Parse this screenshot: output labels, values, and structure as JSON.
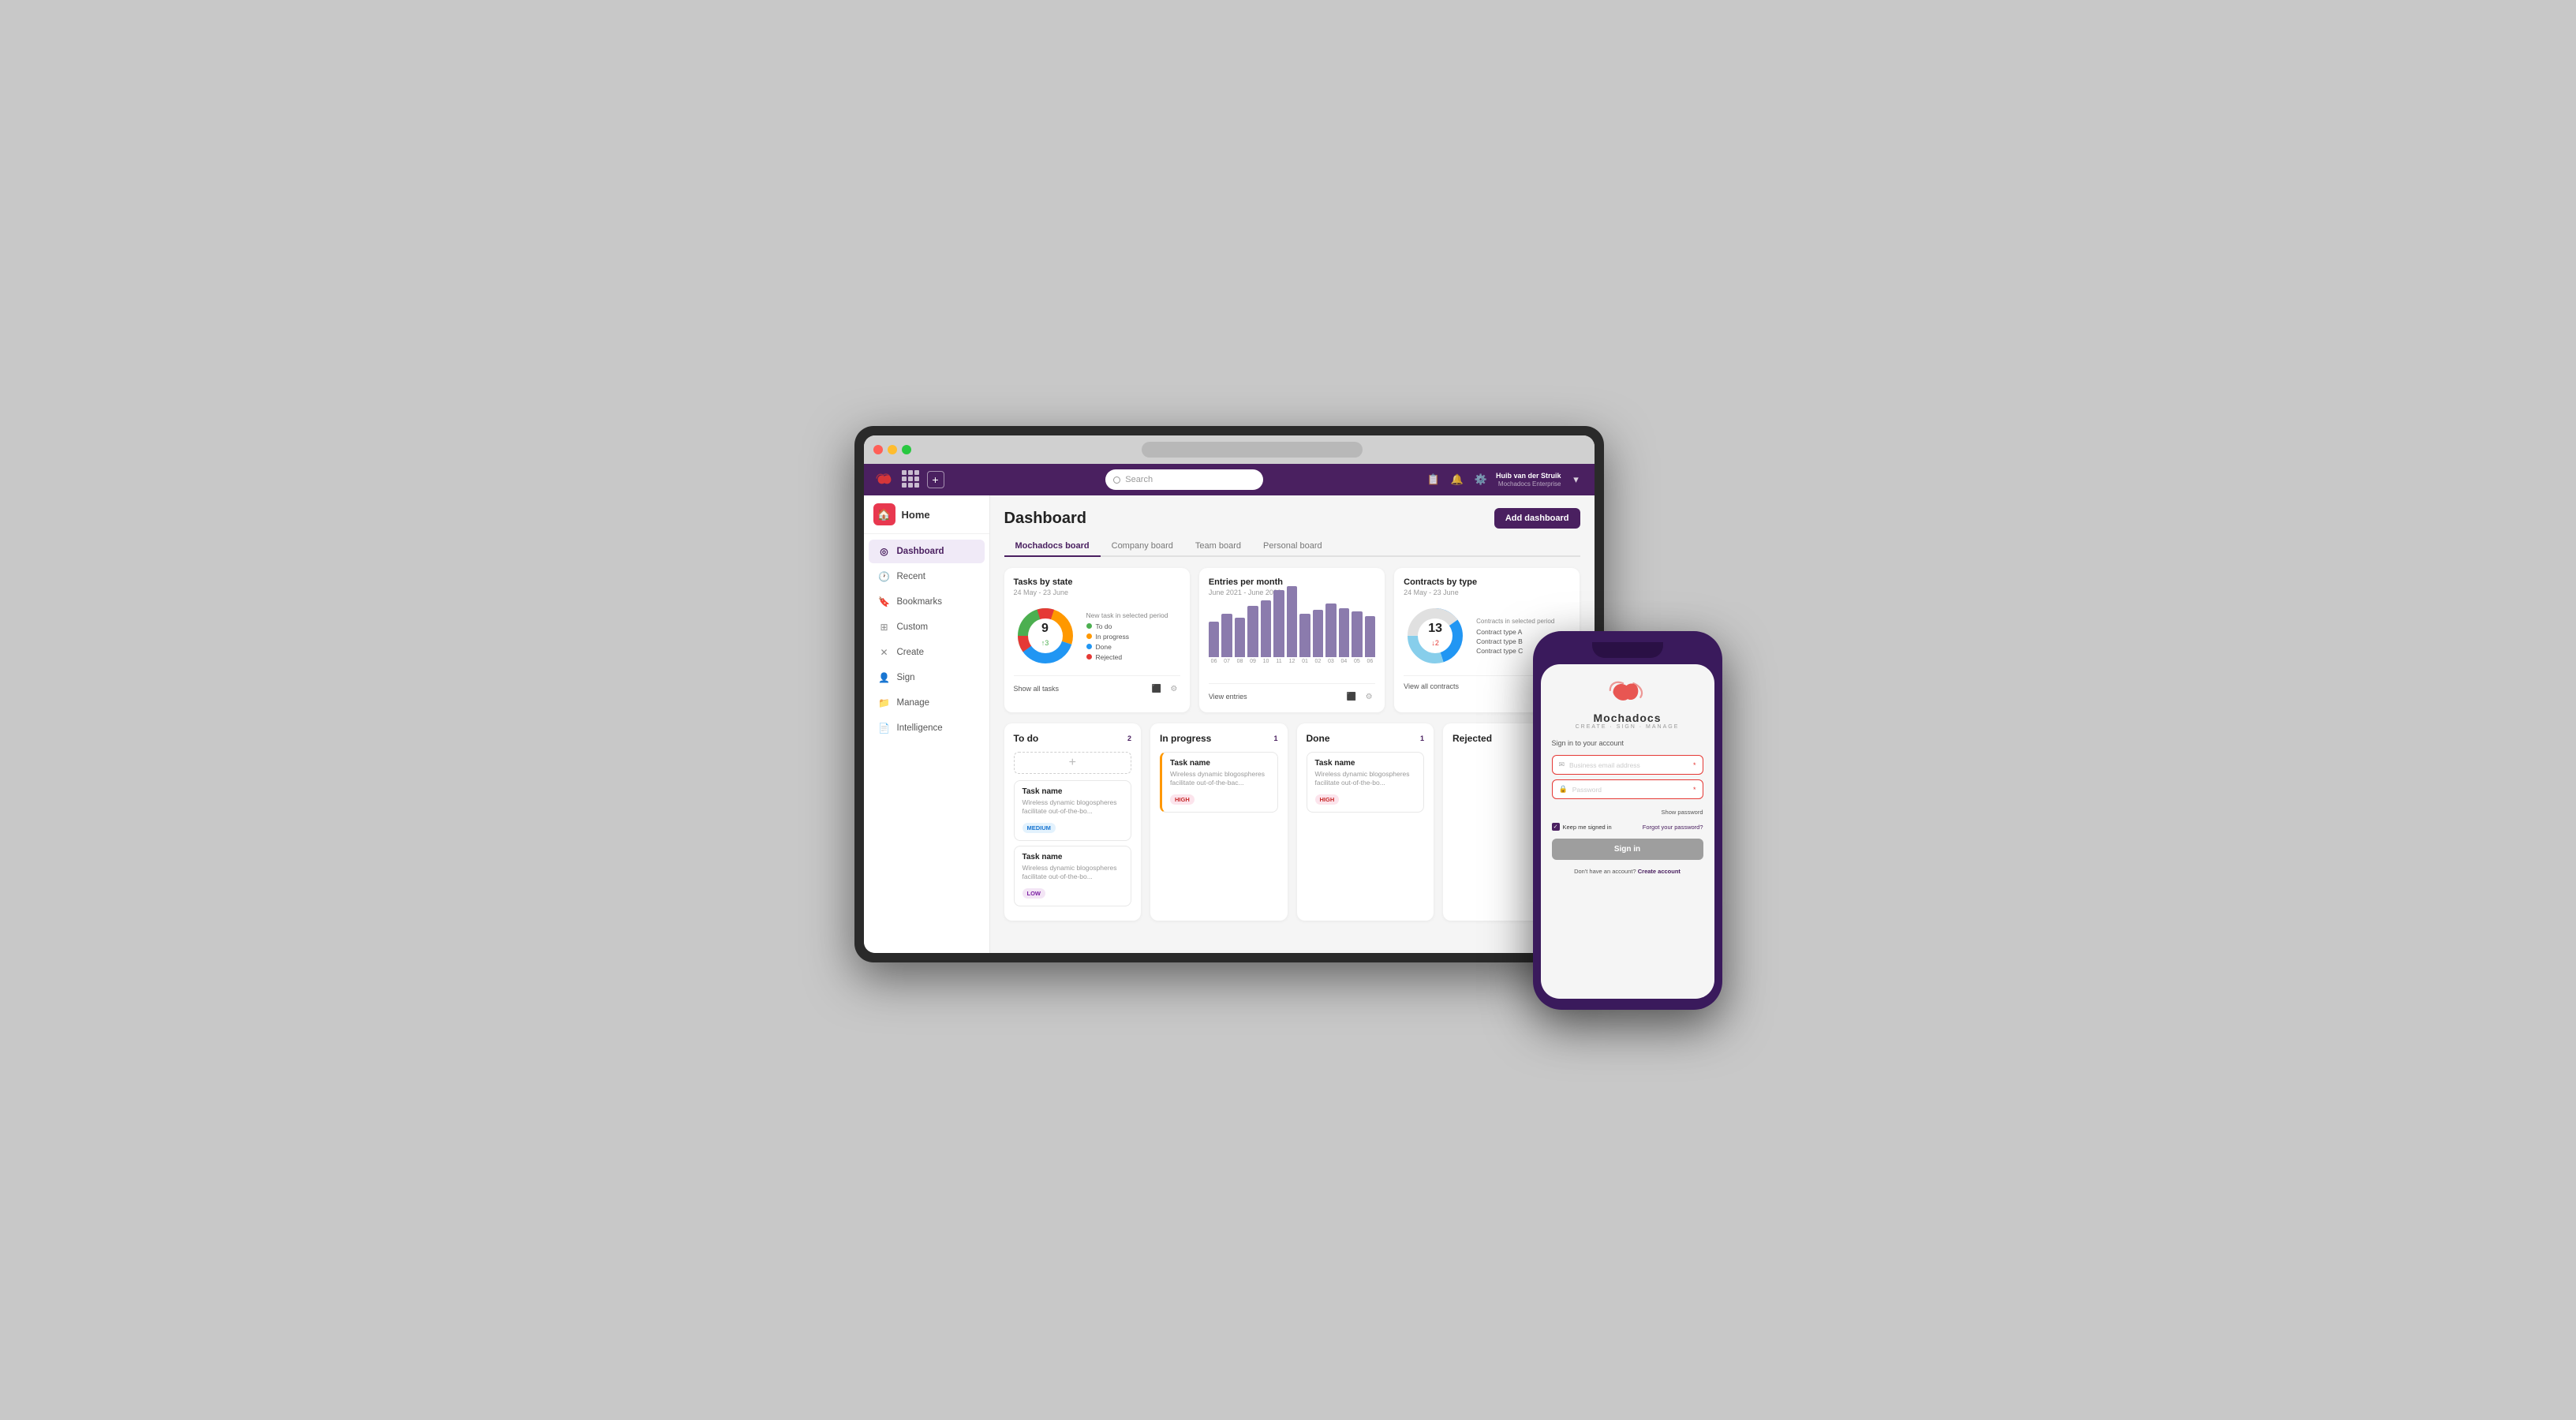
{
  "browser": {
    "traffic_lights": [
      "red",
      "yellow",
      "green"
    ]
  },
  "topnav": {
    "search_placeholder": "Search",
    "user_name": "Huib van der Struik",
    "user_company": "Mochadocs Enterprise"
  },
  "sidebar": {
    "home_label": "Home",
    "items": [
      {
        "id": "dashboard",
        "label": "Dashboard",
        "active": true
      },
      {
        "id": "recent",
        "label": "Recent",
        "active": false
      },
      {
        "id": "bookmarks",
        "label": "Bookmarks",
        "active": false
      },
      {
        "id": "custom",
        "label": "Custom",
        "active": false
      },
      {
        "id": "create",
        "label": "Create",
        "active": false
      },
      {
        "id": "sign",
        "label": "Sign",
        "active": false
      },
      {
        "id": "manage",
        "label": "Manage",
        "active": false
      },
      {
        "id": "intelligence",
        "label": "Intelligence",
        "active": false
      }
    ]
  },
  "page": {
    "title": "Dashboard",
    "add_dashboard_btn": "Add dashboard"
  },
  "tabs": [
    {
      "id": "mochadocs",
      "label": "Mochadocs board",
      "active": true
    },
    {
      "id": "company",
      "label": "Company board",
      "active": false
    },
    {
      "id": "team",
      "label": "Team board",
      "active": false
    },
    {
      "id": "personal",
      "label": "Personal board",
      "active": false
    }
  ],
  "chart_tasks": {
    "title": "Tasks by state",
    "subtitle": "24 May - 23 June",
    "new_task_label": "New task in selected period",
    "count": "9",
    "change": "↑3",
    "legend": [
      {
        "label": "To do",
        "color": "#4caf50"
      },
      {
        "label": "In progress",
        "color": "#ff9800"
      },
      {
        "label": "Done",
        "color": "#2196f3"
      },
      {
        "label": "Rejected",
        "color": "#e53935"
      }
    ],
    "footer_link": "Show all tasks",
    "donut_segments": [
      {
        "color": "#4caf50",
        "value": 30
      },
      {
        "color": "#ff9800",
        "value": 25
      },
      {
        "color": "#2196f3",
        "value": 35
      },
      {
        "color": "#e53935",
        "value": 10
      }
    ]
  },
  "chart_entries": {
    "title": "Entries per month",
    "subtitle": "June 2021 - June 2022",
    "footer_link": "View entries",
    "bars": [
      {
        "label": "06",
        "height": 45
      },
      {
        "label": "07",
        "height": 55
      },
      {
        "label": "08",
        "height": 50
      },
      {
        "label": "09",
        "height": 65
      },
      {
        "label": "10",
        "height": 72
      },
      {
        "label": "11",
        "height": 85
      },
      {
        "label": "12",
        "height": 90
      },
      {
        "label": "01",
        "height": 55
      },
      {
        "label": "02",
        "height": 60
      },
      {
        "label": "03",
        "height": 68
      },
      {
        "label": "04",
        "height": 62
      },
      {
        "label": "05",
        "height": 58
      },
      {
        "label": "06",
        "height": 52
      }
    ]
  },
  "chart_contracts": {
    "title": "Contracts by type",
    "subtitle": "24 May - 23 June",
    "contracts_label": "Contracts in selected period",
    "count": "13",
    "change": "↓2",
    "footer_link": "View all contracts",
    "legend": [
      {
        "label": "Contract type A"
      },
      {
        "label": "Contract type B"
      },
      {
        "label": "Contract type C"
      }
    ],
    "donut_segments": [
      {
        "color": "#2196f3",
        "value": 45
      },
      {
        "color": "#87ceeb",
        "value": 30
      },
      {
        "color": "#e0e0e0",
        "value": 25
      }
    ]
  },
  "kanban": {
    "columns": [
      {
        "id": "todo",
        "title": "To do",
        "count": "2",
        "has_add": true,
        "cards": [
          {
            "title": "Task name",
            "desc": "Wireless dynamic blogospheres facilitate out-of-the-bo...",
            "tag": "MEDIUM",
            "tag_class": "tag-medium"
          },
          {
            "title": "Task name",
            "desc": "Wireless dynamic blogospheres facilitate out-of-the-bo...",
            "tag": "LOW",
            "tag_class": "tag-low"
          }
        ]
      },
      {
        "id": "inprogress",
        "title": "In progress",
        "count": "1",
        "has_add": false,
        "cards": [
          {
            "title": "Task name",
            "desc": "Wireless dynamic blogospheres facilitate out-of-the-bac...",
            "tag": "HIGH",
            "tag_class": "tag-high",
            "in_progress": true
          }
        ]
      },
      {
        "id": "done",
        "title": "Done",
        "count": "1",
        "has_add": false,
        "cards": [
          {
            "title": "Task name",
            "desc": "Wireless dynamic blogospheres facilitate out-of-the-bo...",
            "tag": "HIGH",
            "tag_class": "tag-high"
          }
        ]
      },
      {
        "id": "rejected",
        "title": "Rejected",
        "count": "",
        "has_add": false,
        "cards": []
      }
    ]
  },
  "phone": {
    "signin_title": "Sign in to your account",
    "email_placeholder": "Business email address",
    "password_placeholder": "Password",
    "show_password": "Show password",
    "keep_signed": "Keep me signed in",
    "forgot_password": "Forgot your password?",
    "signin_btn": "Sign in",
    "no_account": "Don't have an account?",
    "create_account": "Create account",
    "brand_name": "Mochadocs",
    "tagline": "Create · Sign · Manage"
  }
}
